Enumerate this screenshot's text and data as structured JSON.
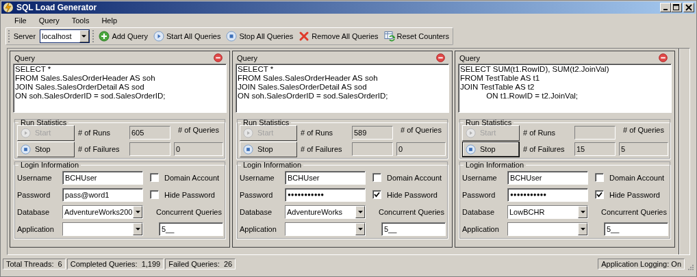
{
  "window": {
    "title": "SQL Load Generator"
  },
  "menu": [
    {
      "label": "File"
    },
    {
      "label": "Query"
    },
    {
      "label": "Tools"
    },
    {
      "label": "Help"
    }
  ],
  "toolbar": {
    "server_label": "Server",
    "server_value": "localhost",
    "buttons": [
      {
        "kind": "add",
        "label": "Add Query"
      },
      {
        "kind": "start",
        "label": "Start All Queries"
      },
      {
        "kind": "stop",
        "label": "Stop All Queries"
      },
      {
        "kind": "remove",
        "label": "Remove All Queries"
      },
      {
        "kind": "reset",
        "label": "Reset Counters"
      }
    ]
  },
  "panels": [
    {
      "header": "Query",
      "query": "SELECT *\nFROM Sales.SalesOrderHeader AS soh\nJOIN Sales.SalesOrderDetail AS sod\nON soh.SalesOrderID = sod.SalesOrderID;",
      "run_stats": {
        "title": "Run Statistics",
        "start": {
          "label": "Start",
          "disabled": true
        },
        "stop": {
          "label": "Stop",
          "focused": false
        },
        "runs_label": "# of Runs",
        "runs": "605",
        "failures_label": "# of Failures",
        "queries_label": "# of Queries",
        "queries": "0"
      },
      "login": {
        "title": "Login Information",
        "username_label": "Username",
        "username": "BCHUser",
        "domain_label": "Domain Account",
        "domain_account": false,
        "password_label": "Password",
        "password": "pass@word1",
        "hide_label": "Hide Password",
        "hide_password": false,
        "database_label": "Database",
        "database": "AdventureWorks200",
        "concurrent_label": "Concurrent Queries",
        "application_label": "Application",
        "concurrent": "5__"
      }
    },
    {
      "header": "Query",
      "query": "SELECT *\nFROM Sales.SalesOrderHeader AS soh\nJOIN Sales.SalesOrderDetail AS sod\nON soh.SalesOrderID = sod.SalesOrderID;",
      "run_stats": {
        "title": "Run Statistics",
        "start": {
          "label": "Start",
          "disabled": true
        },
        "stop": {
          "label": "Stop",
          "focused": false
        },
        "runs_label": "# of Runs",
        "runs": "589",
        "failures_label": "# of Failures",
        "queries_label": "# of Queries",
        "queries": "0"
      },
      "login": {
        "title": "Login Information",
        "username_label": "Username",
        "username": "BCHUser",
        "domain_label": "Domain Account",
        "domain_account": false,
        "password_label": "Password",
        "password": "●●●●●●●●●●●",
        "hide_label": "Hide Password",
        "hide_password": true,
        "database_label": "Database",
        "database": "AdventureWorks",
        "concurrent_label": "Concurrent Queries",
        "application_label": "Application",
        "concurrent": "5__"
      }
    },
    {
      "header": "Query",
      "query": "SELECT SUM(t1.RowID), SUM(t2.JoinVal)\nFROM TestTable AS t1\nJOIN TestTable AS t2\n            ON t1.RowID = t2.JoinVal;",
      "run_stats": {
        "title": "Run Statistics",
        "start": {
          "label": "Start",
          "disabled": true
        },
        "stop": {
          "label": "Stop",
          "focused": true
        },
        "runs_label": "# of Runs",
        "failures_label": "# of Failures",
        "failures": "15",
        "queries_label": "# of Queries",
        "queries": "5"
      },
      "login": {
        "title": "Login Information",
        "username_label": "Username",
        "username": "BCHUser",
        "domain_label": "Domain Account",
        "domain_account": false,
        "password_label": "Password",
        "password": "●●●●●●●●●●●",
        "hide_label": "Hide Password",
        "hide_password": true,
        "database_label": "Database",
        "database": "LowBCHR",
        "concurrent_label": "Concurrent Queries",
        "application_label": "Application",
        "concurrent": "5__"
      }
    }
  ],
  "status_bar": {
    "left": [
      "Total Threads:  6",
      "Completed Queries:  1,199",
      "Failed Queries:  26"
    ],
    "right": "Application Logging: On"
  }
}
